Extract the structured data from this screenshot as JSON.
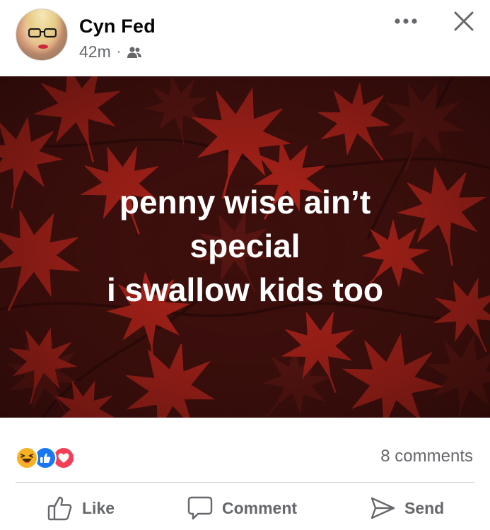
{
  "post": {
    "author": "Cyn Fed",
    "time": "42m",
    "separator": "·",
    "audience_icon": "friends-icon",
    "image_text_lines": [
      "penny wise ain’t",
      "special",
      "i swallow kids too"
    ],
    "image_background_color": "#3b0f0c",
    "leaf_color": "#b2231a"
  },
  "reactions": {
    "icons": [
      "haha-icon",
      "like-icon",
      "love-icon"
    ],
    "comments_label": "8 comments"
  },
  "actions": {
    "like_label": "Like",
    "comment_label": "Comment",
    "send_label": "Send"
  },
  "colors": {
    "text_primary": "#050505",
    "text_secondary": "#65676b",
    "like_blue": "#1877f2",
    "love_red": "#f33e58",
    "haha_yellow": "#f7b125"
  }
}
